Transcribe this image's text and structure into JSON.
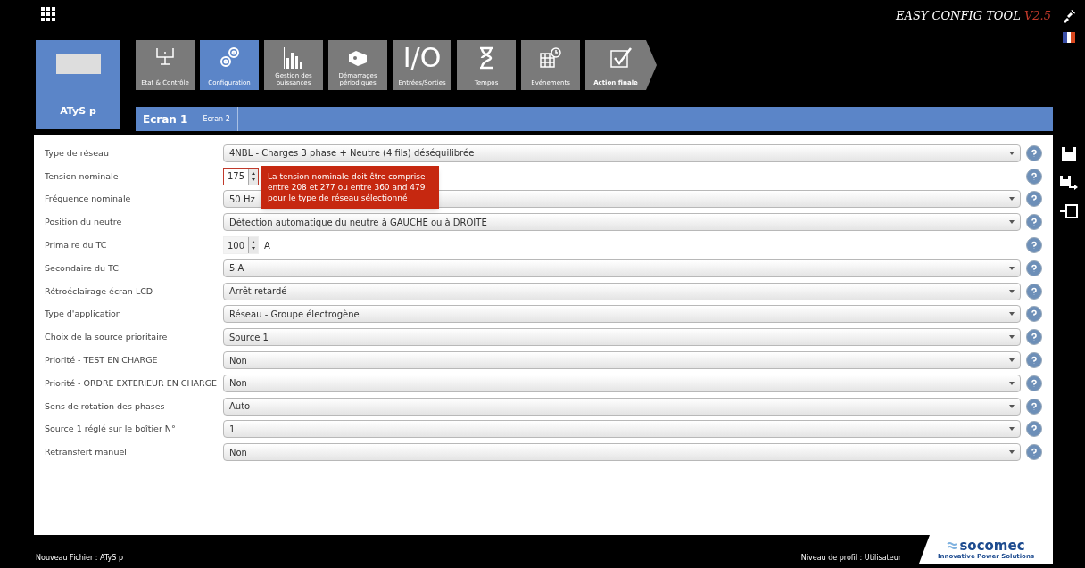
{
  "app": {
    "title": "EASY CONFIG TOOL",
    "version": "V2.5"
  },
  "device": {
    "name": "ATyS p"
  },
  "nav_tabs": [
    {
      "label": "Etat & Contrôle",
      "selected": false
    },
    {
      "label": "Configuration",
      "selected": true
    },
    {
      "label": "Gestion des puissances",
      "selected": false
    },
    {
      "label": "Démarrages périodiques",
      "selected": false
    },
    {
      "label": "Entrées/Sorties",
      "icon_text": "I/O",
      "selected": false
    },
    {
      "label": "Tempos",
      "selected": false
    },
    {
      "label": "Evénements",
      "selected": false
    },
    {
      "label": "Action finale",
      "selected": false
    }
  ],
  "screen_tabs": [
    {
      "label": "Ecran 1",
      "selected": true
    },
    {
      "label": "Ecran 2",
      "selected": false
    }
  ],
  "rows": [
    {
      "label": "Type de réseau",
      "kind": "select",
      "value": "4NBL - Charges 3 phase + Neutre (4 fils) déséquilibrée"
    },
    {
      "label": "Tension nominale",
      "kind": "spinner",
      "value": "175",
      "error": true,
      "tooltip": "La tension nominale doit être comprise entre 208 et 277 ou entre 360 and 479 pour le type de réseau sélectionné"
    },
    {
      "label": "Fréquence nominale",
      "kind": "select",
      "value": "50 Hz"
    },
    {
      "label": "Position du neutre",
      "kind": "select",
      "value": "Détection automatique du neutre à GAUCHE ou à DROITE"
    },
    {
      "label": "Primaire du TC",
      "kind": "spinner",
      "value": "100",
      "error": false,
      "unit": "A"
    },
    {
      "label": "Secondaire du TC",
      "kind": "select",
      "value": "5 A"
    },
    {
      "label": "Rétroéclairage écran LCD",
      "kind": "select",
      "value": "Arrêt retardé"
    },
    {
      "label": "Type d'application",
      "kind": "select",
      "value": "Réseau - Groupe électrogène"
    },
    {
      "label": "Choix de la source prioritaire",
      "kind": "select",
      "value": "Source 1"
    },
    {
      "label": "Priorité - TEST EN CHARGE",
      "kind": "select",
      "value": "Non"
    },
    {
      "label": "Priorité - ORDRE EXTERIEUR EN CHARGE",
      "kind": "select",
      "value": "Non"
    },
    {
      "label": "Sens de rotation des phases",
      "kind": "select",
      "value": "Auto"
    },
    {
      "label": "Source 1 réglé sur le boîtier N°",
      "kind": "select",
      "value": "1"
    },
    {
      "label": "Retransfert manuel",
      "kind": "select",
      "value": "Non"
    }
  ],
  "status_bar": {
    "file": "Nouveau Fichier : ATyS p",
    "profile": "Niveau de profil : Utilisateur"
  },
  "logo": {
    "name": "socomec",
    "tagline": "Innovative Power Solutions"
  }
}
